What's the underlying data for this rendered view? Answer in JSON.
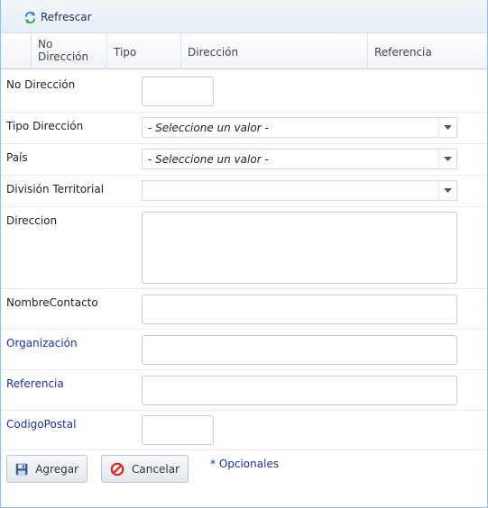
{
  "toolbar": {
    "refresh_label": "Refrescar"
  },
  "grid": {
    "columns": [
      {
        "label_line1": "No",
        "label_line2": "Dirección"
      },
      {
        "label": "Tipo"
      },
      {
        "label": "Dirección"
      },
      {
        "label": "Referencia"
      }
    ]
  },
  "form": {
    "no_direccion": {
      "label": "No Dirección",
      "value": ""
    },
    "tipo_direccion": {
      "label": "Tipo Dirección",
      "selected": "- Seleccione un valor -"
    },
    "pais": {
      "label": "País",
      "selected": "- Seleccione un valor -"
    },
    "division_territorial": {
      "label": "División Territorial",
      "selected": ""
    },
    "direccion": {
      "label": "Direccion",
      "value": ""
    },
    "nombre_contacto": {
      "label": "NombreContacto",
      "value": ""
    },
    "organizacion": {
      "label": "Organización",
      "value": ""
    },
    "referencia": {
      "label": "Referencia",
      "value": ""
    },
    "codigo_postal": {
      "label": "CodigoPostal",
      "value": ""
    }
  },
  "actions": {
    "add_label": "Agregar",
    "cancel_label": "Cancelar",
    "optional_note": "* Opcionales"
  },
  "colors": {
    "optional_label": "#1a31a6",
    "toolbar_bg": "#e6eef7",
    "cancel_icon": "#d9261c"
  },
  "icons": {
    "refresh": "refresh-icon",
    "save": "floppy-disk-icon",
    "cancel": "cancel-circle-icon",
    "dropdown": "chevron-down-icon"
  }
}
